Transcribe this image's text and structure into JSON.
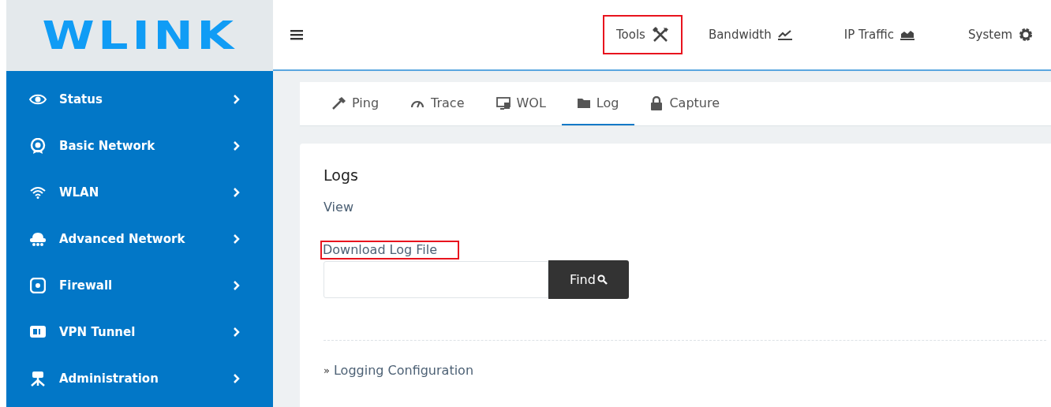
{
  "logo": "WLINK",
  "topnav": [
    {
      "label": "Tools",
      "highlighted": true
    },
    {
      "label": "Bandwidth",
      "highlighted": false
    },
    {
      "label": "IP Traffic",
      "highlighted": false
    },
    {
      "label": "System",
      "highlighted": false
    }
  ],
  "sidebar": {
    "items": [
      {
        "label": "Status"
      },
      {
        "label": "Basic Network"
      },
      {
        "label": "WLAN"
      },
      {
        "label": "Advanced Network"
      },
      {
        "label": "Firewall"
      },
      {
        "label": "VPN Tunnel"
      },
      {
        "label": "Administration"
      }
    ]
  },
  "tabs": [
    {
      "label": "Ping",
      "selected": false
    },
    {
      "label": "Trace",
      "selected": false
    },
    {
      "label": "WOL",
      "selected": false
    },
    {
      "label": "Log",
      "selected": true
    },
    {
      "label": "Capture",
      "selected": false
    }
  ],
  "card": {
    "title": "Logs",
    "view_link": "View",
    "download_link": {
      "label": "Download Log File",
      "highlighted": true
    },
    "search": {
      "button": "Find"
    },
    "config_marker": "»",
    "config_link": "Logging Configuration"
  }
}
